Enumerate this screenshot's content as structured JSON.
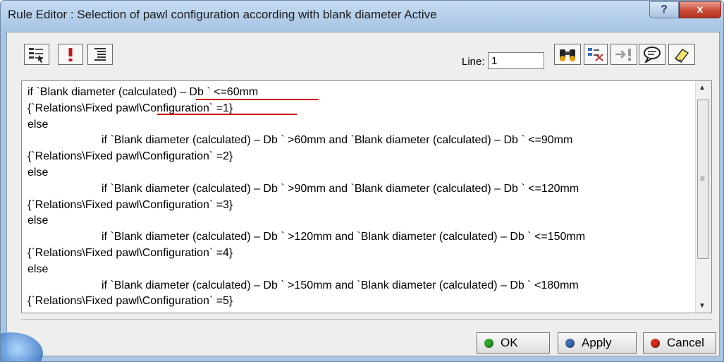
{
  "window": {
    "title": "Rule Editor : Selection of pawl configuration according with blank diameter Active",
    "help_glyph": "?",
    "close_glyph": "x"
  },
  "toolbar": {
    "left_icons": [
      "tree-filter-icon",
      "exclamation-icon",
      "text-lines-icon"
    ],
    "line_label": "Line:",
    "line_value": "1",
    "right_icons": [
      "binoculars-icon",
      "object-browser-icon",
      "arrow-exclamation-icon",
      "speech-bubble-icon",
      "eraser-icon"
    ]
  },
  "editor": {
    "lines": [
      {
        "text": "if `Blank diameter (calculated) – Db ` <=60mm",
        "indent": false
      },
      {
        "text": "{`Relations\\Fixed pawl\\Configuration` =1}",
        "indent": false
      },
      {
        "text": "else",
        "indent": false
      },
      {
        "text": "if `Blank diameter (calculated) – Db ` >60mm and `Blank diameter (calculated) – Db ` <=90mm",
        "indent": true
      },
      {
        "text": "{`Relations\\Fixed pawl\\Configuration` =2}",
        "indent": false
      },
      {
        "text": "else",
        "indent": false
      },
      {
        "text": "if `Blank diameter (calculated) – Db ` >90mm and `Blank diameter (calculated) – Db ` <=120mm",
        "indent": true
      },
      {
        "text": "{`Relations\\Fixed pawl\\Configuration` =3}",
        "indent": false
      },
      {
        "text": "else",
        "indent": false
      },
      {
        "text": "if `Blank diameter (calculated) – Db ` >120mm and `Blank diameter (calculated) – Db ` <=150mm",
        "indent": true
      },
      {
        "text": "{`Relations\\Fixed pawl\\Configuration` =4}",
        "indent": false
      },
      {
        "text": "else",
        "indent": false
      },
      {
        "text": "if `Blank diameter (calculated) – Db ` >150mm and `Blank diameter (calculated) – Db ` <180mm",
        "indent": true
      },
      {
        "text": "{`Relations\\Fixed pawl\\Configuration` =5}",
        "indent": false
      }
    ],
    "scroll_up": "▲",
    "scroll_down": "▼",
    "scroll_grip": "≡"
  },
  "buttons": {
    "ok": {
      "label": "OK",
      "color": "#2fa82f"
    },
    "apply": {
      "label": "Apply",
      "color": "#3f6fb3"
    },
    "cancel": {
      "label": "Cancel",
      "color": "#d92a1e"
    }
  },
  "colors": {
    "annotation_underline": "#cc1111"
  }
}
